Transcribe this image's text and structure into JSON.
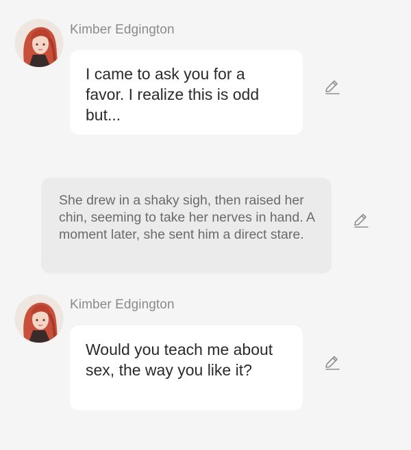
{
  "messages": [
    {
      "type": "character",
      "sender": "Kimber Edgington",
      "text": "I came to ask you for a favor. I realize this is odd but..."
    },
    {
      "type": "narration",
      "text": "She drew in a shaky sigh, then raised her chin, seeming to take her nerves in hand. A moment later, she sent him a direct stare."
    },
    {
      "type": "character",
      "sender": "Kimber Edgington",
      "text": "Would you teach me about sex, the way you like it?"
    }
  ],
  "icons": {
    "edit": "pencil-icon",
    "avatar": "character-avatar"
  },
  "colors": {
    "background": "#f5f5f5",
    "bubble": "#ffffff",
    "narration_bubble": "#ebebeb",
    "sender_name": "#8a8a8a",
    "hair": "#c8503a"
  }
}
